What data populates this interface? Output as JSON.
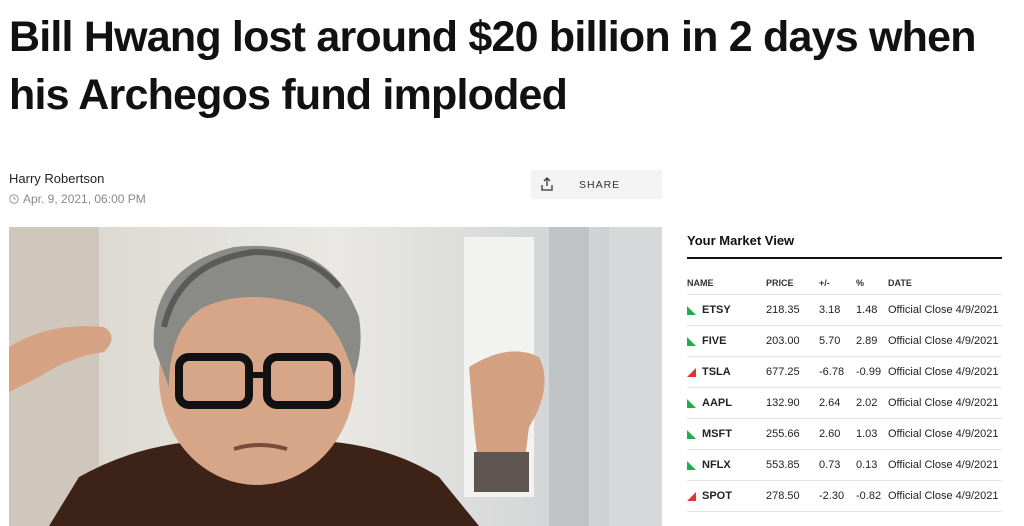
{
  "article": {
    "headline": "Bill Hwang lost around $20 billion in 2 days when his Archegos fund imploded",
    "author": "Harry Robertson",
    "date": "Apr. 9, 2021, 06:00 PM",
    "share_label": "SHARE"
  },
  "market_view": {
    "title": "Your Market View",
    "columns": [
      "NAME",
      "PRICE",
      "+/-",
      "%",
      "DATE"
    ],
    "rows": [
      {
        "name": "ETSY",
        "price": "218.35",
        "change": "3.18",
        "percent": "1.48",
        "date": "Official Close 4/9/2021",
        "direction": "up"
      },
      {
        "name": "FIVE",
        "price": "203.00",
        "change": "5.70",
        "percent": "2.89",
        "date": "Official Close 4/9/2021",
        "direction": "up"
      },
      {
        "name": "TSLA",
        "price": "677.25",
        "change": "-6.78",
        "percent": "-0.99",
        "date": "Official Close 4/9/2021",
        "direction": "down"
      },
      {
        "name": "AAPL",
        "price": "132.90",
        "change": "2.64",
        "percent": "2.02",
        "date": "Official Close 4/9/2021",
        "direction": "up"
      },
      {
        "name": "MSFT",
        "price": "255.66",
        "change": "2.60",
        "percent": "1.03",
        "date": "Official Close 4/9/2021",
        "direction": "up"
      },
      {
        "name": "NFLX",
        "price": "553.85",
        "change": "0.73",
        "percent": "0.13",
        "date": "Official Close 4/9/2021",
        "direction": "up"
      },
      {
        "name": "SPOT",
        "price": "278.50",
        "change": "-2.30",
        "percent": "-0.82",
        "date": "Official Close 4/9/2021",
        "direction": "down"
      }
    ]
  },
  "colors": {
    "up": "#1fae4b",
    "down": "#e0352b"
  },
  "icons": {
    "share": "share-upload-icon",
    "clock": "clock-icon",
    "up": "triangle-up-arrow-icon",
    "down": "triangle-down-arrow-icon"
  }
}
